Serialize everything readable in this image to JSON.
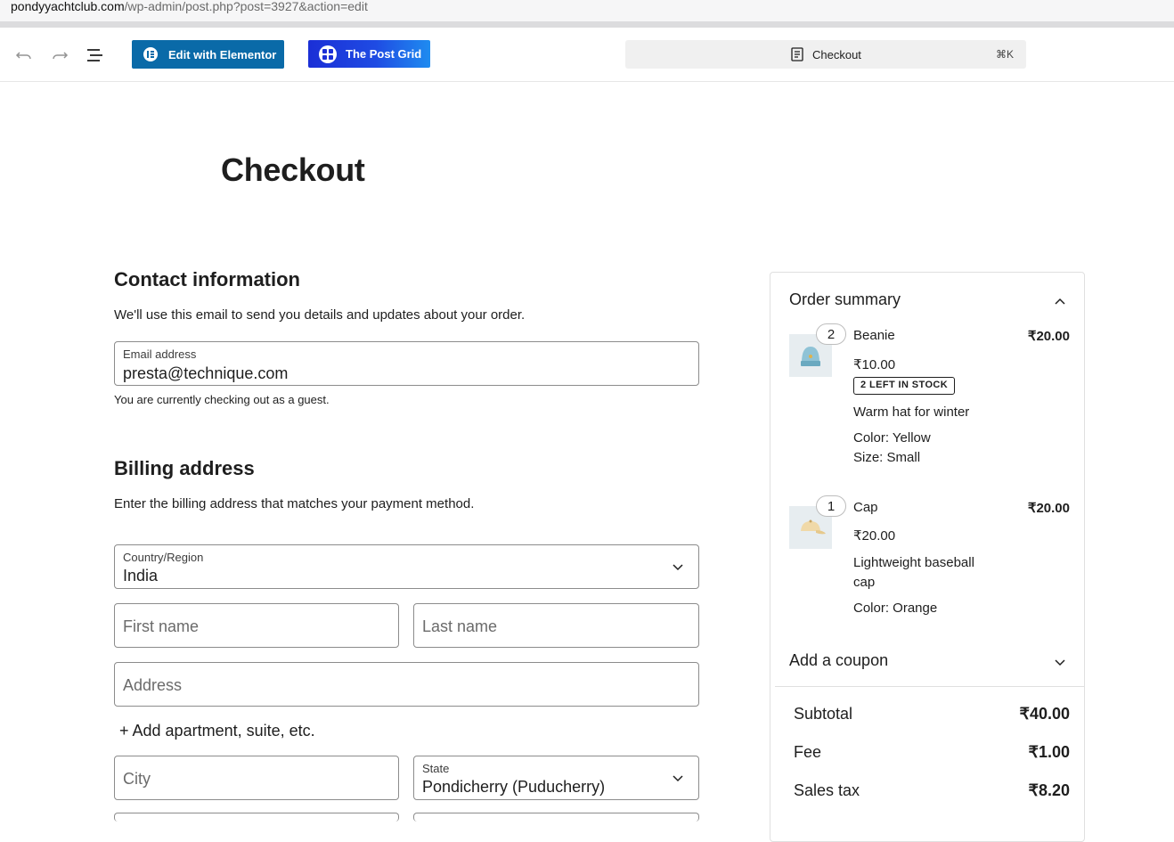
{
  "browser": {
    "url_domain": "pondyyachtclub.com",
    "url_path": "/wp-admin/post.php?post=3927&action=edit"
  },
  "toolbar": {
    "undo_icon": "undo-icon",
    "redo_icon": "redo-icon",
    "list_icon": "document-overview-icon",
    "elementor_label": "Edit with Elementor",
    "postgrid_label": "The Post Grid",
    "command_title": "Checkout",
    "command_shortcut": "⌘K"
  },
  "page": {
    "title": "Checkout"
  },
  "contact": {
    "heading": "Contact information",
    "description": "We'll use this email to send you details and updates about your order.",
    "email_label": "Email address",
    "email_value": "presta@technique.com",
    "guest_note": "You are currently checking out as a guest."
  },
  "billing": {
    "heading": "Billing address",
    "description": "Enter the billing address that matches your payment method.",
    "country_label": "Country/Region",
    "country_value": "India",
    "first_name_placeholder": "First name",
    "last_name_placeholder": "Last name",
    "address_placeholder": "Address",
    "add_apartment": "+ Add apartment, suite, etc.",
    "city_placeholder": "City",
    "state_label": "State",
    "state_value": "Pondicherry (Puducherry)"
  },
  "summary": {
    "title": "Order summary",
    "items": [
      {
        "qty": "2",
        "name": "Beanie",
        "total": "₹20.00",
        "unit_price": "₹10.00",
        "stock_badge": "2 LEFT IN STOCK",
        "description": "Warm hat for winter",
        "attr1": "Color: Yellow",
        "attr2": "Size: Small"
      },
      {
        "qty": "1",
        "name": "Cap",
        "total": "₹20.00",
        "unit_price": "₹20.00",
        "description_line1": "Lightweight baseball",
        "description_line2": "cap",
        "attr1": "Color: Orange"
      }
    ],
    "coupon_label": "Add a coupon",
    "subtotal_label": "Subtotal",
    "subtotal_value": "₹40.00",
    "fee_label": "Fee",
    "fee_value": "₹1.00",
    "tax_label": "Sales tax",
    "tax_value": "₹8.20"
  },
  "colors": {
    "elementor_blue": "#0a6aa8",
    "postgrid_gradient_start": "#1b2fd6",
    "postgrid_gradient_end": "#1f8cf0"
  }
}
